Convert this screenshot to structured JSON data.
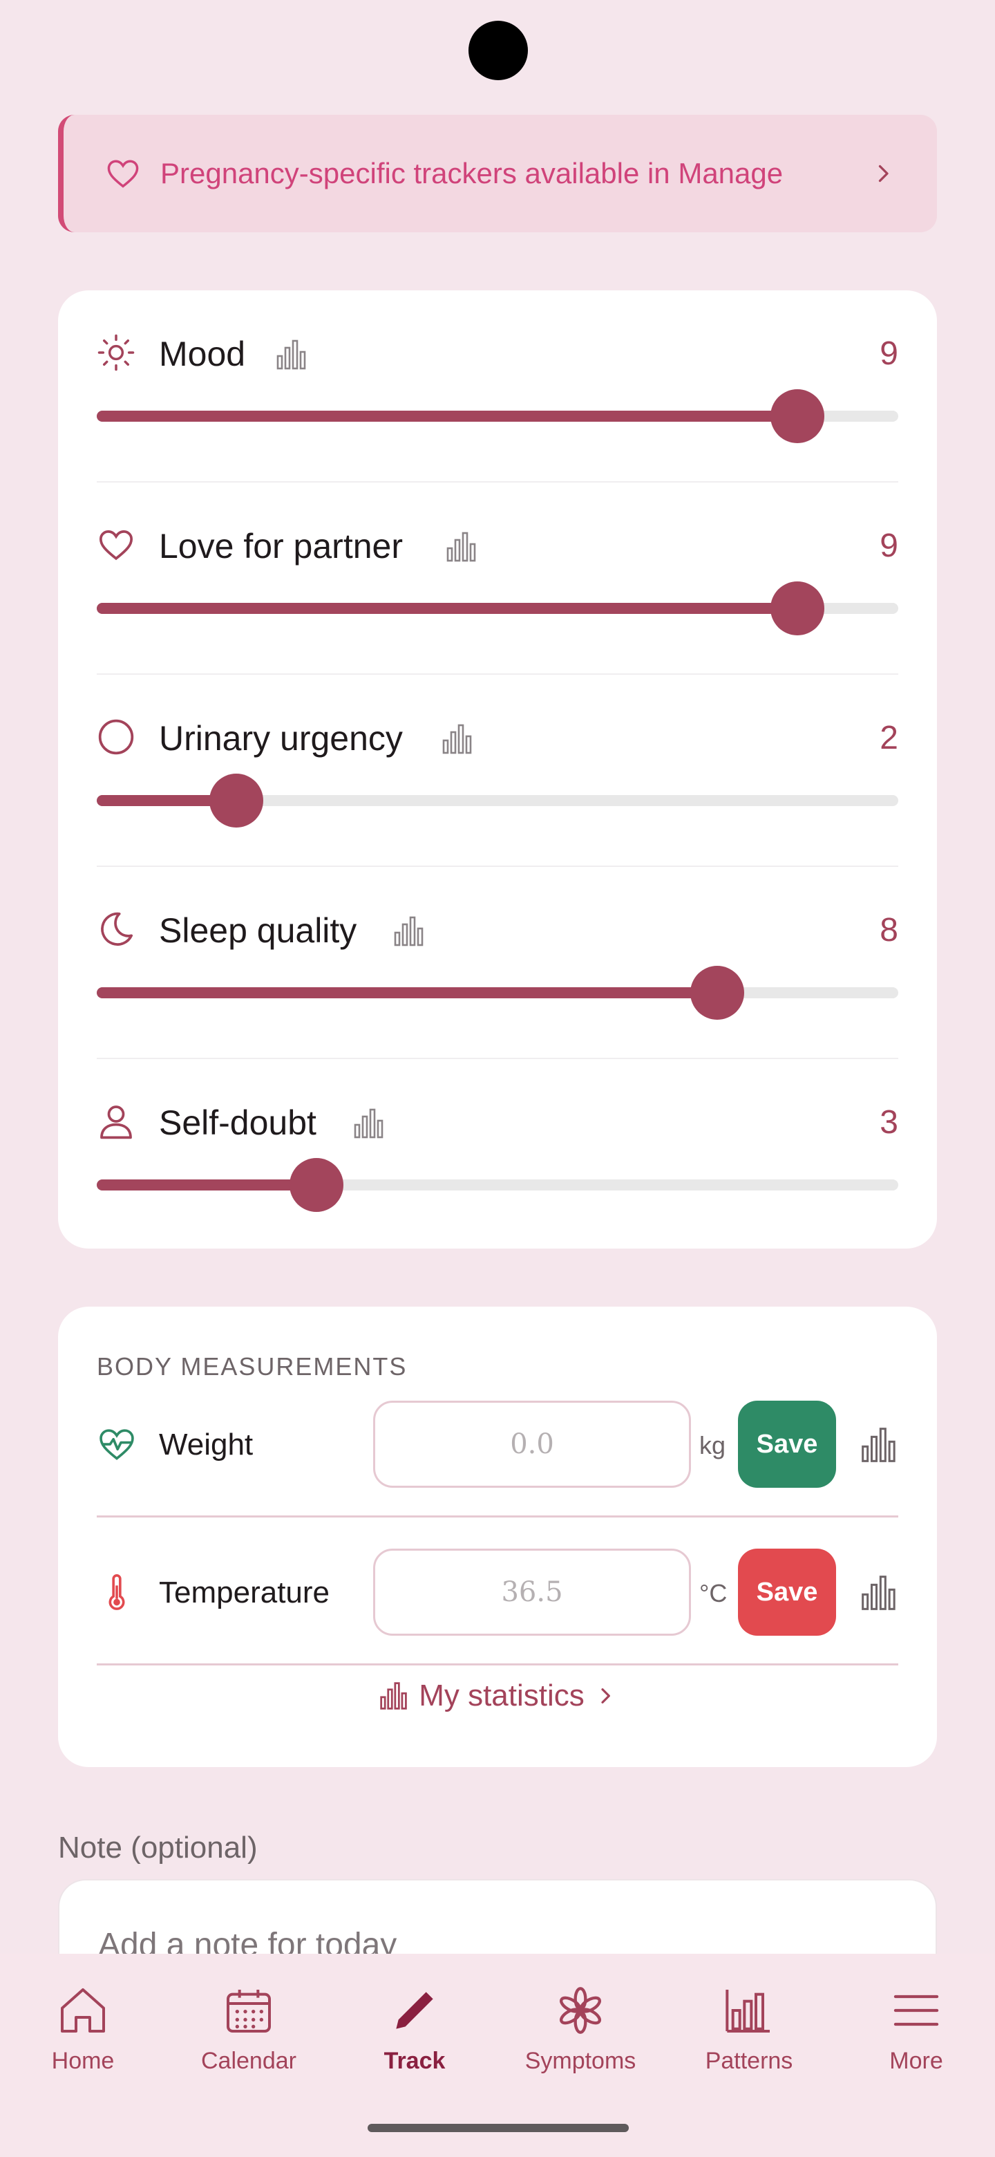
{
  "banner": {
    "text": "Pregnancy-specific trackers available in Manage",
    "icon": "heart-icon",
    "chevron": "chevron-right-icon"
  },
  "trackers": [
    {
      "name": "Mood",
      "value": "9",
      "level": 9,
      "max": 10,
      "icon": "sun-icon"
    },
    {
      "name": "Love for partner",
      "value": "9",
      "level": 9,
      "max": 10,
      "icon": "heart-icon"
    },
    {
      "name": "Urinary urgency",
      "value": "2",
      "level": 2,
      "max": 10,
      "icon": "circle-icon"
    },
    {
      "name": "Sleep quality",
      "value": "8",
      "level": 8,
      "max": 10,
      "icon": "moon-icon"
    },
    {
      "name": "Self-doubt",
      "value": "3",
      "level": 3,
      "max": 10,
      "icon": "person-icon"
    }
  ],
  "body": {
    "title": "BODY MEASUREMENTS",
    "weight": {
      "label": "Weight",
      "placeholder": "0.0",
      "unit": "kg",
      "save": "Save",
      "save_color": "#2e8b66"
    },
    "temperature": {
      "label": "Temperature",
      "placeholder": "36.5",
      "unit": "°C",
      "save": "Save",
      "save_color": "#e24a4f"
    },
    "stats_link": "My statistics"
  },
  "note": {
    "label": "Note (optional)",
    "placeholder": "Add a note for today"
  },
  "nav": {
    "items": [
      {
        "label": "Home",
        "icon": "home-icon"
      },
      {
        "label": "Calendar",
        "icon": "calendar-icon"
      },
      {
        "label": "Track",
        "icon": "pencil-icon",
        "active": true
      },
      {
        "label": "Symptoms",
        "icon": "asterisk-icon"
      },
      {
        "label": "Patterns",
        "icon": "bar-chart-icon"
      },
      {
        "label": "More",
        "icon": "menu-icon"
      }
    ]
  },
  "colors": {
    "accent": "#a3455c",
    "banner_text": "#d0437a",
    "background": "#f5e6ec"
  }
}
